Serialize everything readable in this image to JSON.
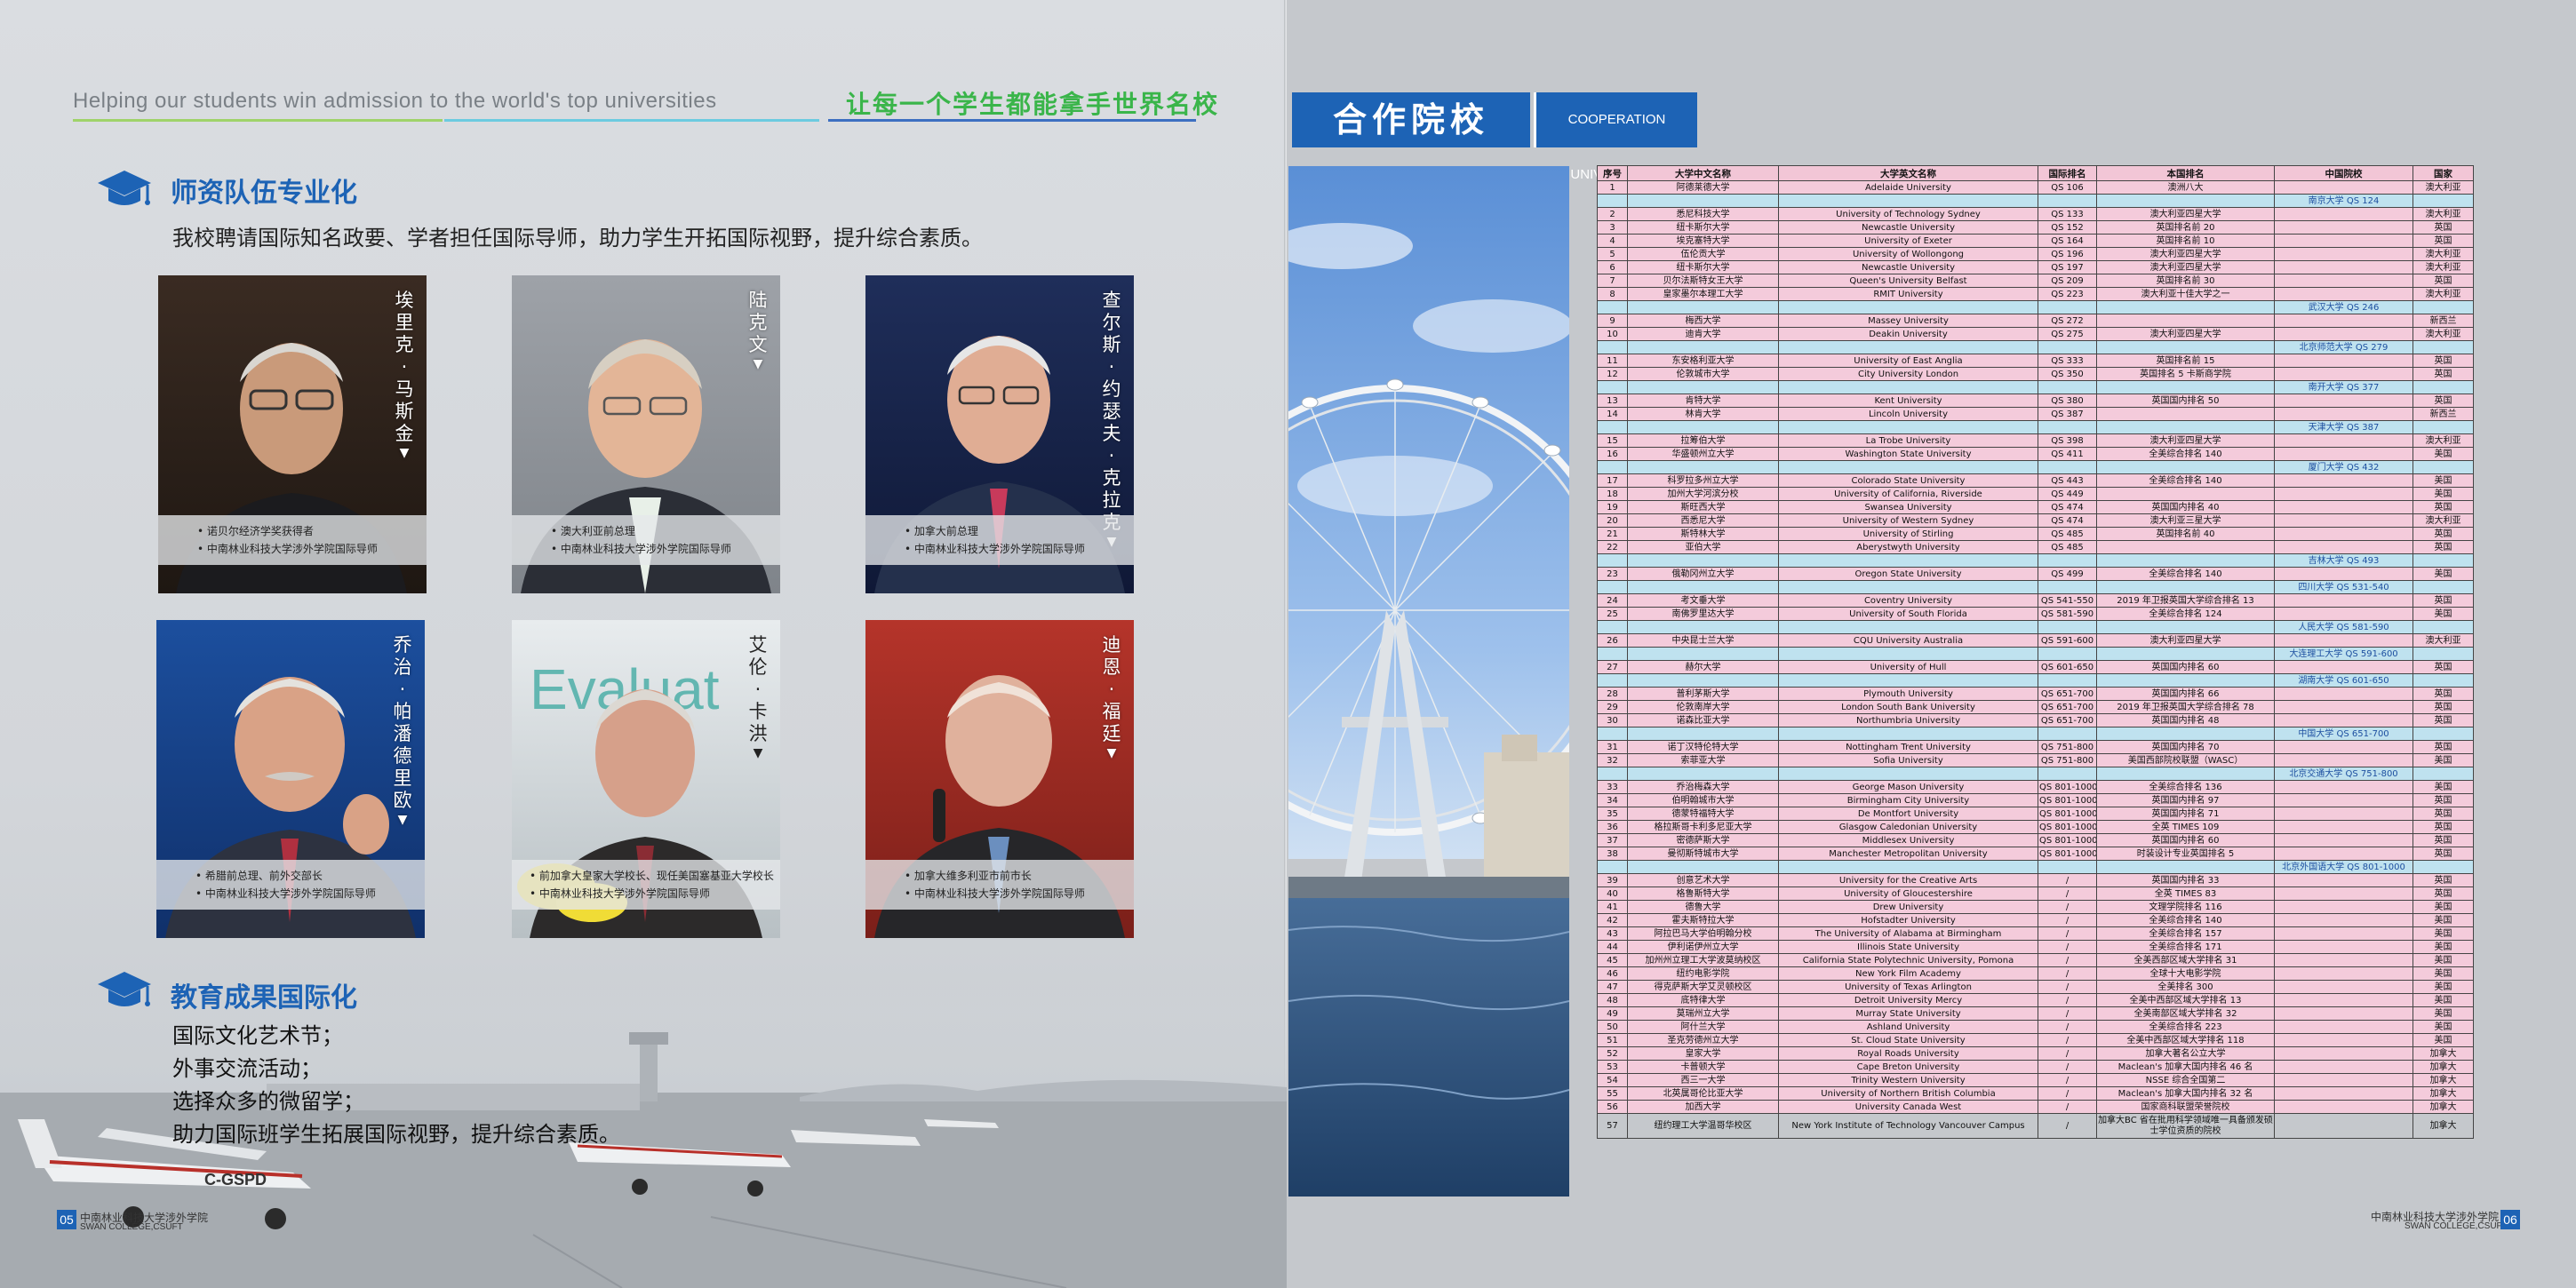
{
  "left_page": {
    "tagline_en": "Helping our students win admission to the world's top universities",
    "tagline_cn": "让每一个学生都能拿手世界名校",
    "section1_title": "师资队伍专业化",
    "section1_desc": "我校聘请国际知名政要、学者担任国际导师，助力学生开拓国际视野，提升综合素质。",
    "mentors": [
      {
        "name": "埃里克·马斯金",
        "lines": [
          "• 诺贝尔经济学奖获得者",
          "• 中南林业科技大学涉外学院国际导师"
        ]
      },
      {
        "name": "陆克文",
        "lines": [
          "• 澳大利亚前总理",
          "• 中南林业科技大学涉外学院国际导师"
        ]
      },
      {
        "name": "查尔斯·约瑟夫·克拉克",
        "lines": [
          "• 加拿大前总理",
          "• 中南林业科技大学涉外学院国际导师"
        ]
      },
      {
        "name": "乔治·帕潘德里欧",
        "lines": [
          "• 希腊前总理、前外交部长",
          "• 中南林业科技大学涉外学院国际导师"
        ]
      },
      {
        "name": "艾伦·卡洪",
        "lines": [
          "• 前加拿大皇家大学校长、现任美国塞基亚大学校长",
          "• 中南林业科技大学涉外学院国际导师"
        ]
      },
      {
        "name": "迪恩·福廷",
        "lines": [
          "• 加拿大维多利亚市前市长",
          "• 中南林业科技大学涉外学院国际导师"
        ]
      }
    ],
    "section2_title": "教育成果国际化",
    "achievements": [
      "国际文化艺术节；",
      "外事交流活动；",
      "选择众多的微留学；",
      "助力国际班学生拓展国际视野，提升综合素质。"
    ],
    "page_number": "05",
    "footer_cn": "中南林业科技大学涉外学院",
    "footer_en": "SWAN COLLEGE,CSUFT",
    "plane_reg": "C-GSPD"
  },
  "right_page": {
    "title_cn": "合作院校",
    "title_en": "COOPERATION UNIVERSITIES",
    "page_number": "06",
    "footer_cn": "中南林业科技大学涉外学院",
    "footer_en": "SWAN COLLEGE,CSUFT",
    "table": {
      "headers": [
        "序号",
        "大学中文名称",
        "大学英文名称",
        "国际排名",
        "本国排名",
        "中国院校",
        "国家"
      ],
      "rows": [
        {
          "t": "u",
          "c": [
            "1",
            "阿德莱德大学",
            "Adelaide University",
            "QS 106",
            "澳洲八大",
            "",
            "澳大利亚"
          ]
        },
        {
          "t": "h",
          "c": "南京大学  QS 124"
        },
        {
          "t": "u",
          "c": [
            "2",
            "悉尼科技大学",
            "University of Technology Sydney",
            "QS 133",
            "澳大利亚四星大学",
            "",
            "澳大利亚"
          ]
        },
        {
          "t": "u",
          "c": [
            "3",
            "纽卡斯尔大学",
            "Newcastle University",
            "QS 152",
            "英国排名前 20",
            "",
            "英国"
          ]
        },
        {
          "t": "u",
          "c": [
            "4",
            "埃克塞特大学",
            "University of Exeter",
            "QS 164",
            "英国排名前 10",
            "",
            "英国"
          ]
        },
        {
          "t": "u",
          "c": [
            "5",
            "伍伦贡大学",
            "University of Wollongong",
            "QS 196",
            "澳大利亚四星大学",
            "",
            "澳大利亚"
          ]
        },
        {
          "t": "u",
          "c": [
            "6",
            "纽卡斯尔大学",
            "Newcastle University",
            "QS 197",
            "澳大利亚四星大学",
            "",
            "澳大利亚"
          ]
        },
        {
          "t": "u",
          "c": [
            "7",
            "贝尔法斯特女王大学",
            "Queen's University Belfast",
            "QS 209",
            "英国排名前 30",
            "",
            "英国"
          ]
        },
        {
          "t": "u",
          "c": [
            "8",
            "皇家墨尔本理工大学",
            "RMIT University",
            "QS 223",
            "澳大利亚十佳大学之一",
            "",
            "澳大利亚"
          ]
        },
        {
          "t": "h",
          "c": "武汉大学  QS 246"
        },
        {
          "t": "u",
          "c": [
            "9",
            "梅西大学",
            "Massey University",
            "QS 272",
            "",
            "",
            "新西兰"
          ]
        },
        {
          "t": "u",
          "c": [
            "10",
            "迪肯大学",
            "Deakin University",
            "QS 275",
            "澳大利亚四星大学",
            "",
            "澳大利亚"
          ]
        },
        {
          "t": "h",
          "c": "北京师范大学  QS 279"
        },
        {
          "t": "u",
          "c": [
            "11",
            "东安格利亚大学",
            "University of East Anglia",
            "QS 333",
            "英国排名前 15",
            "",
            "英国"
          ]
        },
        {
          "t": "u",
          "c": [
            "12",
            "伦敦城市大学",
            "City University London",
            "QS 350",
            "英国排名 5 卡斯商学院",
            "",
            "英国"
          ]
        },
        {
          "t": "h",
          "c": "南开大学  QS 377"
        },
        {
          "t": "u",
          "c": [
            "13",
            "肯特大学",
            "Kent University",
            "QS 380",
            "英国国内排名 50",
            "",
            "英国"
          ]
        },
        {
          "t": "u",
          "c": [
            "14",
            "林肯大学",
            "Lincoln University",
            "QS 387",
            "",
            "",
            "新西兰"
          ]
        },
        {
          "t": "h",
          "c": "天津大学  QS 387"
        },
        {
          "t": "u",
          "c": [
            "15",
            "拉筹伯大学",
            "La Trobe University",
            "QS 398",
            "澳大利亚四星大学",
            "",
            "澳大利亚"
          ]
        },
        {
          "t": "u",
          "c": [
            "16",
            "华盛顿州立大学",
            "Washington State University",
            "QS 411",
            "全美综合排名 140",
            "",
            "美国"
          ]
        },
        {
          "t": "h",
          "c": "厦门大学  QS 432"
        },
        {
          "t": "u",
          "c": [
            "17",
            "科罗拉多州立大学",
            "Colorado State University",
            "QS 443",
            "全美综合排名 140",
            "",
            "美国"
          ]
        },
        {
          "t": "u",
          "c": [
            "18",
            "加州大学河滨分校",
            "University of California, Riverside",
            "QS 449",
            "",
            "",
            "美国"
          ]
        },
        {
          "t": "u",
          "c": [
            "19",
            "斯旺西大学",
            "Swansea University",
            "QS 474",
            "英国国内排名 40",
            "",
            "英国"
          ]
        },
        {
          "t": "u",
          "c": [
            "20",
            "西悉尼大学",
            "University of Western Sydney",
            "QS 474",
            "澳大利亚三星大学",
            "",
            "澳大利亚"
          ]
        },
        {
          "t": "u",
          "c": [
            "21",
            "斯特林大学",
            "University of Stirling",
            "QS 485",
            "英国排名前 40",
            "",
            "英国"
          ]
        },
        {
          "t": "u",
          "c": [
            "22",
            "亚伯大学",
            "Aberystwyth University",
            "QS 485",
            "",
            "",
            "英国"
          ]
        },
        {
          "t": "h",
          "c": "吉林大学  QS 493"
        },
        {
          "t": "u",
          "c": [
            "23",
            "俄勒冈州立大学",
            "Oregon State University",
            "QS 499",
            "全美综合排名 140",
            "",
            "美国"
          ]
        },
        {
          "t": "h",
          "c": "四川大学  QS 531-540"
        },
        {
          "t": "u",
          "c": [
            "24",
            "考文垂大学",
            "Coventry University",
            "QS 541-550",
            "2019 年卫报英国大学综合排名 13",
            "",
            "英国"
          ]
        },
        {
          "t": "u",
          "c": [
            "25",
            "南佛罗里达大学",
            "University of South Florida",
            "QS 581-590",
            "全美综合排名 124",
            "",
            "美国"
          ]
        },
        {
          "t": "h",
          "c": "人民大学  QS 581-590"
        },
        {
          "t": "u",
          "c": [
            "26",
            "中央昆士兰大学",
            "CQU University Australia",
            "QS 591-600",
            "澳大利亚四星大学",
            "",
            "澳大利亚"
          ]
        },
        {
          "t": "h",
          "c": "大连理工大学  QS 591-600"
        },
        {
          "t": "u",
          "c": [
            "27",
            "赫尔大学",
            "University of Hull",
            "QS 601-650",
            "英国国内排名 60",
            "",
            "英国"
          ]
        },
        {
          "t": "h",
          "c": "湖南大学  QS 601-650"
        },
        {
          "t": "u",
          "c": [
            "28",
            "普利茅斯大学",
            "Plymouth University",
            "QS 651-700",
            "英国国内排名 66",
            "",
            "英国"
          ]
        },
        {
          "t": "u",
          "c": [
            "29",
            "伦敦南岸大学",
            "London South Bank University",
            "QS 651-700",
            "2019 年卫报英国大学综合排名 78",
            "",
            "英国"
          ]
        },
        {
          "t": "u",
          "c": [
            "30",
            "诺森比亚大学",
            "Northumbria University",
            "QS 651-700",
            "英国国内排名 48",
            "",
            "英国"
          ]
        },
        {
          "t": "h",
          "c": "中国大学  QS 651-700"
        },
        {
          "t": "u",
          "c": [
            "31",
            "诺丁汉特伦特大学",
            "Nottingham Trent University",
            "QS 751-800",
            "英国国内排名 70",
            "",
            "英国"
          ]
        },
        {
          "t": "u",
          "c": [
            "32",
            "索菲亚大学",
            "Sofia University",
            "QS 751-800",
            "美国西部院校联盟（WASC）",
            "",
            "美国"
          ]
        },
        {
          "t": "h",
          "c": "北京交通大学  QS 751-800"
        },
        {
          "t": "u",
          "c": [
            "33",
            "乔治梅森大学",
            "George Mason University",
            "QS 801-1000",
            "全美综合排名 136",
            "",
            "美国"
          ]
        },
        {
          "t": "u",
          "c": [
            "34",
            "伯明翰城市大学",
            "Birmingham City University",
            "QS 801-1000",
            "英国国内排名 97",
            "",
            "英国"
          ]
        },
        {
          "t": "u",
          "c": [
            "35",
            "德蒙特福特大学",
            "De Montfort University",
            "QS 801-1000",
            "英国国内排名 71",
            "",
            "英国"
          ]
        },
        {
          "t": "u",
          "c": [
            "36",
            "格拉斯哥卡利多尼亚大学",
            "Glasgow Caledonian University",
            "QS 801-1000",
            "全英 TIMES 109",
            "",
            "英国"
          ]
        },
        {
          "t": "u",
          "c": [
            "37",
            "密德萨斯大学",
            "Middlesex University",
            "QS 801-1000",
            "英国国内排名 60",
            "",
            "英国"
          ]
        },
        {
          "t": "u",
          "c": [
            "38",
            "曼彻斯特城市大学",
            "Manchester Metropolitan University",
            "QS 801-1000",
            "时装设计专业英国排名 5",
            "",
            "英国"
          ]
        },
        {
          "t": "h",
          "c": "北京外国语大学 QS 801-1000"
        },
        {
          "t": "g",
          "c": [
            "39",
            "创意艺术大学",
            "University for the Creative Arts",
            "/",
            "英国国内排名 33",
            "",
            "英国"
          ]
        },
        {
          "t": "g",
          "c": [
            "40",
            "格鲁斯特大学",
            "University of Gloucestershire",
            "/",
            "全英 TIMES 83",
            "",
            "英国"
          ]
        },
        {
          "t": "g",
          "c": [
            "41",
            "德鲁大学",
            "Drew University",
            "/",
            "文理学院排名 116",
            "",
            "美国"
          ]
        },
        {
          "t": "g",
          "c": [
            "42",
            "霍夫斯特拉大学",
            "Hofstadter University",
            "/",
            "全美综合排名 140",
            "",
            "美国"
          ]
        },
        {
          "t": "g",
          "c": [
            "43",
            "阿拉巴马大学伯明翰分校",
            "The University of Alabama at Birmingham",
            "/",
            "全美综合排名 157",
            "",
            "美国"
          ]
        },
        {
          "t": "g",
          "c": [
            "44",
            "伊利诺伊州立大学",
            "Illinois State University",
            "/",
            "全美综合排名 171",
            "",
            "美国"
          ]
        },
        {
          "t": "g",
          "c": [
            "45",
            "加州州立理工大学波莫纳校区",
            "California State Polytechnic University, Pomona",
            "/",
            "全美西部区域大学排名 31",
            "",
            "美国"
          ]
        },
        {
          "t": "g",
          "c": [
            "46",
            "纽约电影学院",
            "New York Film Academy",
            "/",
            "全球十大电影学院",
            "",
            "美国"
          ]
        },
        {
          "t": "g",
          "c": [
            "47",
            "得克萨斯大学艾灵顿校区",
            "University of Texas Arlington",
            "/",
            "全美排名 300",
            "",
            "美国"
          ]
        },
        {
          "t": "g",
          "c": [
            "48",
            "底特律大学",
            "Detroit University Mercy",
            "/",
            "全美中西部区域大学排名 13",
            "",
            "美国"
          ]
        },
        {
          "t": "g",
          "c": [
            "49",
            "莫瑞州立大学",
            "Murray State University",
            "/",
            "全美南部区域大学排名 32",
            "",
            "美国"
          ]
        },
        {
          "t": "g",
          "c": [
            "50",
            "阿什兰大学",
            "Ashland University",
            "/",
            "全美综合排名 223",
            "",
            "美国"
          ]
        },
        {
          "t": "g",
          "c": [
            "51",
            "圣克劳德州立大学",
            "St. Cloud State University",
            "/",
            "全美中西部区域大学排名 118",
            "",
            "美国"
          ]
        },
        {
          "t": "g",
          "c": [
            "52",
            "皇家大学",
            "Royal Roads University",
            "/",
            "加拿大著名公立大学",
            "",
            "加拿大"
          ]
        },
        {
          "t": "g",
          "c": [
            "53",
            "卡普顿大学",
            "Cape Breton University",
            "/",
            "Maclean's 加拿大国内排名 46 名",
            "",
            "加拿大"
          ]
        },
        {
          "t": "g",
          "c": [
            "54",
            "西三一大学",
            "Trinity Western University",
            "/",
            "NSSE 综合全国第二",
            "",
            "加拿大"
          ]
        },
        {
          "t": "g",
          "c": [
            "55",
            "北英属哥伦比亚大学",
            "University of Northern British Columbia",
            "/",
            "Maclean's 加拿大国内排名 32 名",
            "",
            "加拿大"
          ]
        },
        {
          "t": "g",
          "c": [
            "56",
            "加西大学",
            "University Canada West",
            "/",
            "国家商科联盟荣誉院校",
            "",
            "加拿大"
          ]
        },
        {
          "t": "tall",
          "c": [
            "57",
            "纽约理工大学温哥华校区",
            "New York Institute of Technology Vancouver Campus",
            "/",
            "加拿大BC 省在批用科学领域唯一具备颁发硕士学位资质的院校",
            "",
            "加拿大"
          ]
        }
      ]
    }
  },
  "colors": {
    "brand_blue": "#1d63b5",
    "tagline_green": "#3ab54a",
    "table_pink": "#f4cbdb",
    "table_blue": "#bfe2ef"
  },
  "icons": [
    "graduation-cap-icon",
    "triangle-down-icon"
  ]
}
